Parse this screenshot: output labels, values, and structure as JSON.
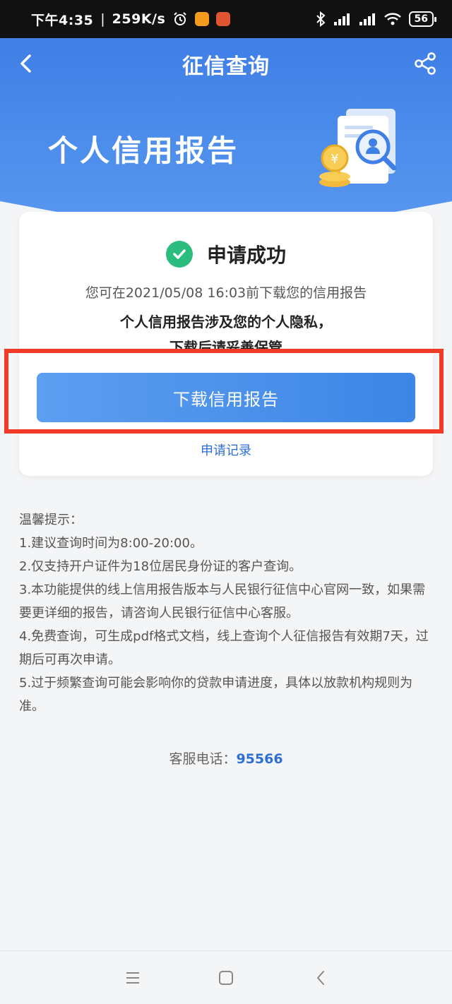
{
  "status_bar": {
    "time": "下午4:35",
    "separator": "|",
    "speed": "259K/s",
    "battery": "56",
    "icons": [
      "alarm-icon",
      "app-icon-orange",
      "app-icon-red",
      "bluetooth-icon",
      "signal-hd-icon",
      "signal-hd-icon",
      "wifi-icon",
      "battery-icon"
    ]
  },
  "header": {
    "title": "征信查询",
    "hero_title": "个人信用报告",
    "back_icon": "chevron-left-icon",
    "share_icon": "share-icon"
  },
  "card": {
    "success_label": "申请成功",
    "message_line1": "您可在2021/05/08 16:03前下载您的信用报告",
    "message_line2": "个人信用报告涉及您的个人隐私，",
    "message_line3": "下载后请妥善保管",
    "download_button": "下载信用报告",
    "records_link": "申请记录"
  },
  "tips": {
    "heading": "温馨提示：",
    "items": [
      "1.建议查询时间为8:00-20:00。",
      "2.仅支持开户证件为18位居民身份证的客户查询。",
      "3.本功能提供的线上信用报告版本与人民银行征信中心官网一致，如果需要更详细的报告，请咨询人民银行征信中心客服。",
      "4.免费查询，可生成pdf格式文档，线上查询个人征信报告有效期7天，过期后可再次申请。",
      "5.过于频繁查询可能会影响你的贷款申请进度，具体以放款机构规则为准。"
    ]
  },
  "hotline": {
    "label": "客服电话：",
    "number": "95566"
  },
  "colors": {
    "header_blue": "#3f7fe6",
    "button_blue": "#4a90e8",
    "success_green": "#2bbd7e",
    "link_blue": "#2d6fd2",
    "highlight_red": "#f23b26"
  }
}
